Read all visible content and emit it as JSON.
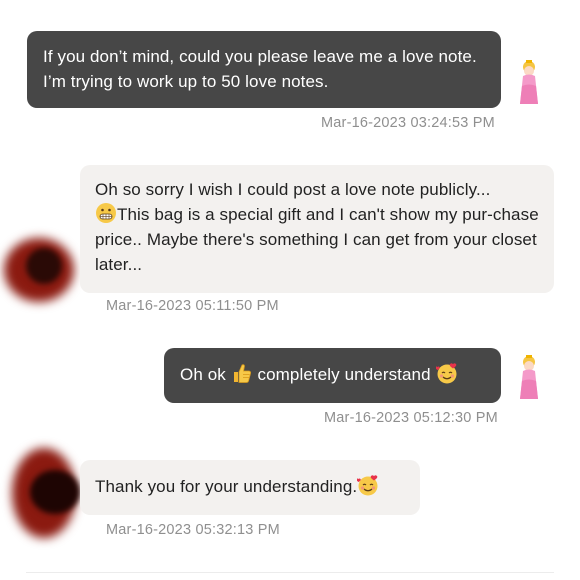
{
  "messages": [
    {
      "sender": "me",
      "text": "If you don’t mind, could you please leave me a love note. I’m trying to work up to 50 love notes.",
      "timestamp": "Mar-16-2023 03:24:53 PM"
    },
    {
      "sender": "other",
      "text_part1": "Oh so sorry I wish I could post a love note publicly...",
      "text_part2": "This bag is a special gift and I can't show my pur-chase price.. Maybe there's something I can get from your closet later...",
      "timestamp": "Mar-16-2023 05:11:50 PM"
    },
    {
      "sender": "me",
      "text_part1": "Oh ok",
      "text_part2": "completely understand",
      "timestamp": "Mar-16-2023 05:12:30 PM"
    },
    {
      "sender": "other",
      "text": "Thank you for your understanding.",
      "timestamp": "Mar-16-2023 05:32:13 PM"
    }
  ],
  "icons": {
    "my_avatar": "princess-peach-avatar",
    "other_avatar": "blurred-avatar",
    "grimace": "grimacing-face-emoji",
    "thumbs_up": "thumbs-up-emoji",
    "heart_face": "smiling-face-with-hearts-emoji"
  },
  "colors": {
    "my_bubble": "#474747",
    "other_bubble": "#f3f1ef",
    "timestamp": "#8f8f8f",
    "avatar_blur": "#8b1a10"
  }
}
